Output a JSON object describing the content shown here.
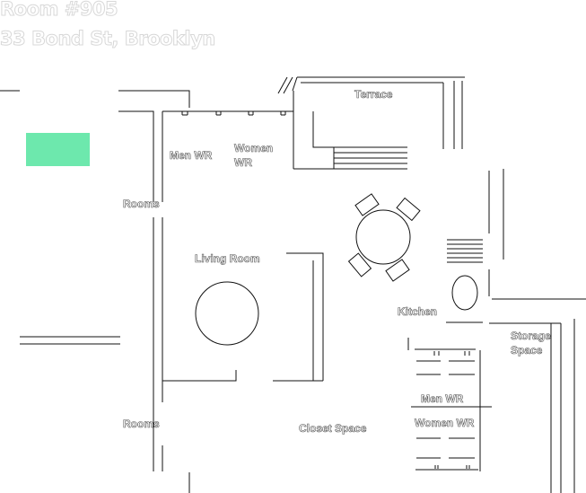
{
  "header": {
    "room": "Room #905",
    "address": "33 Bond St, Brooklyn"
  },
  "labels": {
    "terrace": "Terrace",
    "men_wr_top": "Men WR",
    "women_wr_top": "Women\nWR",
    "rooms_upper": "Rooms",
    "living_room": "Living Room",
    "kitchen": "Kitchen",
    "storage_space": "Storage\nSpace",
    "men_wr_bottom": "Men WR",
    "women_wr_bottom": "Women WR",
    "rooms_lower": "Rooms",
    "closet_space": "Closet Space"
  },
  "colors": {
    "highlight": "#6de8ad",
    "wall": "#111111"
  }
}
